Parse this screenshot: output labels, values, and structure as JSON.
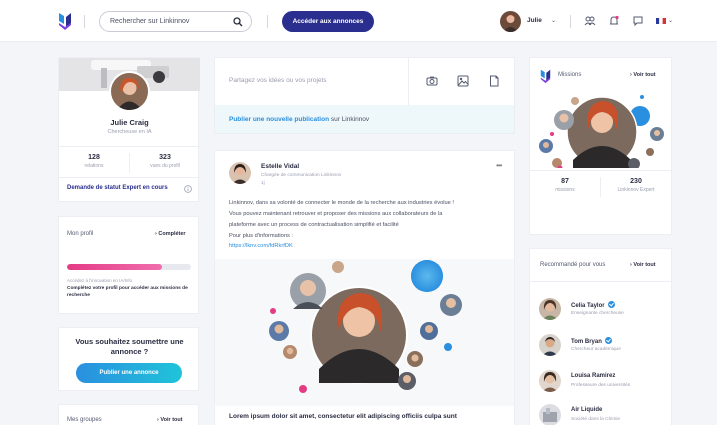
{
  "topbar": {
    "search_placeholder": "Rechercher sur Linkinnov",
    "cta_label": "Accéder aux annonces",
    "user_name": "Julie"
  },
  "profile": {
    "name": "Julie Craig",
    "role": "Chercheuse en IA",
    "relations_count": "128",
    "relations_label": "relations",
    "views_count": "323",
    "views_label": "vues du profil",
    "expert_status_link": "Demande de statut Expert en cours"
  },
  "my_profile": {
    "title": "Mon profil",
    "action": "Compléter",
    "completion_percent": 77,
    "note": "Accédez à l'innovation en IA/Info",
    "cta_text": "Complétez votre profil pour accéder aux missions de recherche"
  },
  "announce": {
    "question": "Vous souhaitez soumettre une annonce ?",
    "button": "Publier une annonce"
  },
  "groups": {
    "title": "Mes groupes",
    "link": "Voir tout"
  },
  "share": {
    "placeholder": "Partagez vos idées ou vos projets",
    "publish_link": "Publier une nouvelle publication",
    "publish_suffix": "sur Linkinnov"
  },
  "post": {
    "author": "Estelle Vidal",
    "author_role": "Chargée de communication Linkinnov",
    "time": "1j",
    "lines": [
      "Linkinnov, dans sa volonté de connecter le monde de la recherche aux industries évolue !",
      "Vous pouvez maintenant retrouver et proposer des missions aux collaborateurs de la",
      "plateforme avec un process de contractualisation simplifié et facilité",
      "Pour plus d'informations :"
    ],
    "url": "https://lknv.com/fdRkrfDK",
    "footer_text": "Lorem ipsum dolor sit amet, consectetur elit adipiscing officiis culpa sunt"
  },
  "missions": {
    "title": "Missions",
    "link": "Voir tout",
    "missions_count": "87",
    "missions_label": "missions",
    "experts_count": "230",
    "experts_label": "Linkinnov Expert"
  },
  "recommended": {
    "title": "Recommandé pour vous",
    "link": "Voir tout",
    "items": [
      {
        "name": "Celia Taylor",
        "sub": "Enseignante chercheuse"
      },
      {
        "name": "Tom Bryan",
        "sub": "Chercheur académique"
      },
      {
        "name": "Louisa Ramirez",
        "sub": "Professeure des universités"
      },
      {
        "name": "Air Liquide",
        "sub": "Société dans la Chimie"
      }
    ]
  },
  "colors": {
    "brand_navy": "#2a2f8f",
    "accent_blue": "#2a8fdf",
    "accent_pink": "#e43b85"
  },
  "icons": [
    "logo-icon",
    "search-icon",
    "network-icon",
    "bell-icon",
    "chat-icon",
    "flag-icon",
    "camera-icon",
    "image-icon",
    "document-icon",
    "info-icon",
    "more-icon",
    "verified-icon"
  ]
}
